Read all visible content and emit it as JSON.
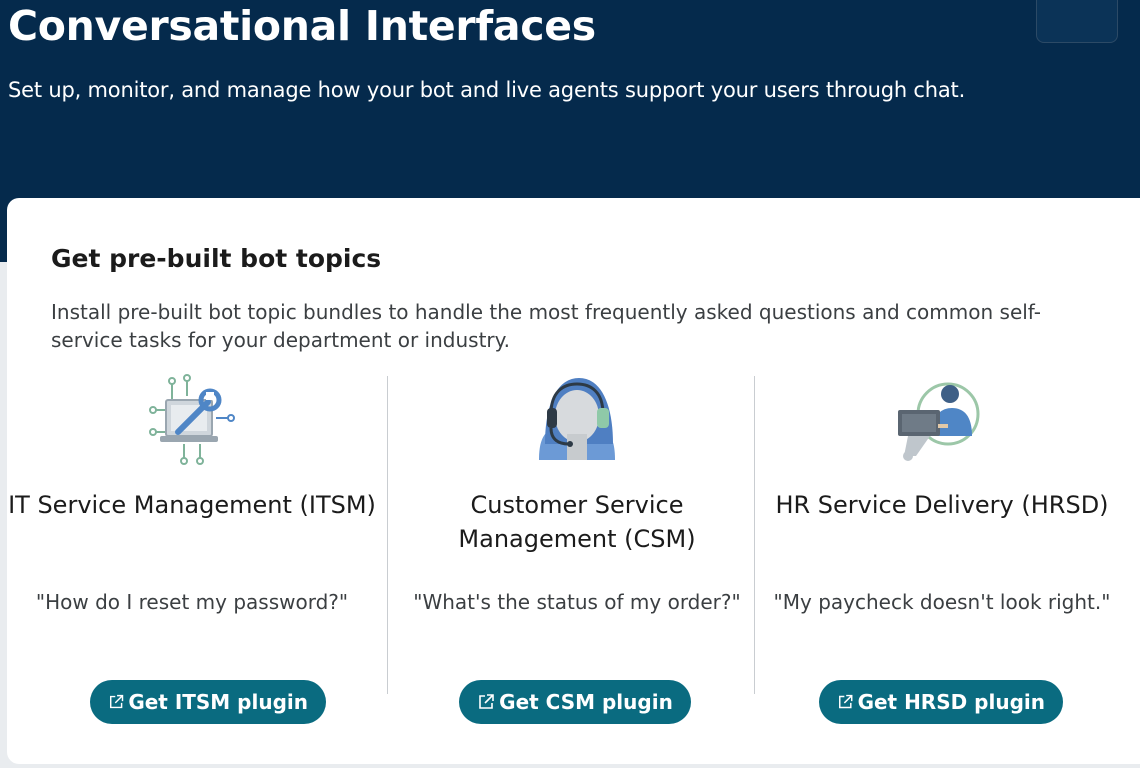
{
  "header": {
    "title": "Conversational Interfaces",
    "subtitle": "Set up, monitor, and manage how your bot and live agents support your users through chat."
  },
  "card": {
    "title": "Get pre-built bot topics",
    "description": "Install pre-built bot topic bundles to handle the most frequently asked questions and common self-service tasks for your department or industry."
  },
  "plugins": [
    {
      "title": "IT Service Management (ITSM)",
      "quote": "\"How do I reset my password?\"",
      "button_label": "Get ITSM plugin",
      "icon": "itsm-laptop-wrench-icon"
    },
    {
      "title": "Customer Service Management (CSM)",
      "quote": "\"What's the status of my order?\"",
      "button_label": "Get CSM plugin",
      "icon": "csm-headset-agent-icon"
    },
    {
      "title": "HR Service Delivery (HRSD)",
      "quote": "\"My paycheck doesn't look right.\"",
      "button_label": "Get HRSD plugin",
      "icon": "hrsd-person-laptop-icon"
    }
  ],
  "colors": {
    "header_bg": "#052a4c",
    "button_bg": "#0a6b80",
    "card_bg": "#ffffff"
  }
}
